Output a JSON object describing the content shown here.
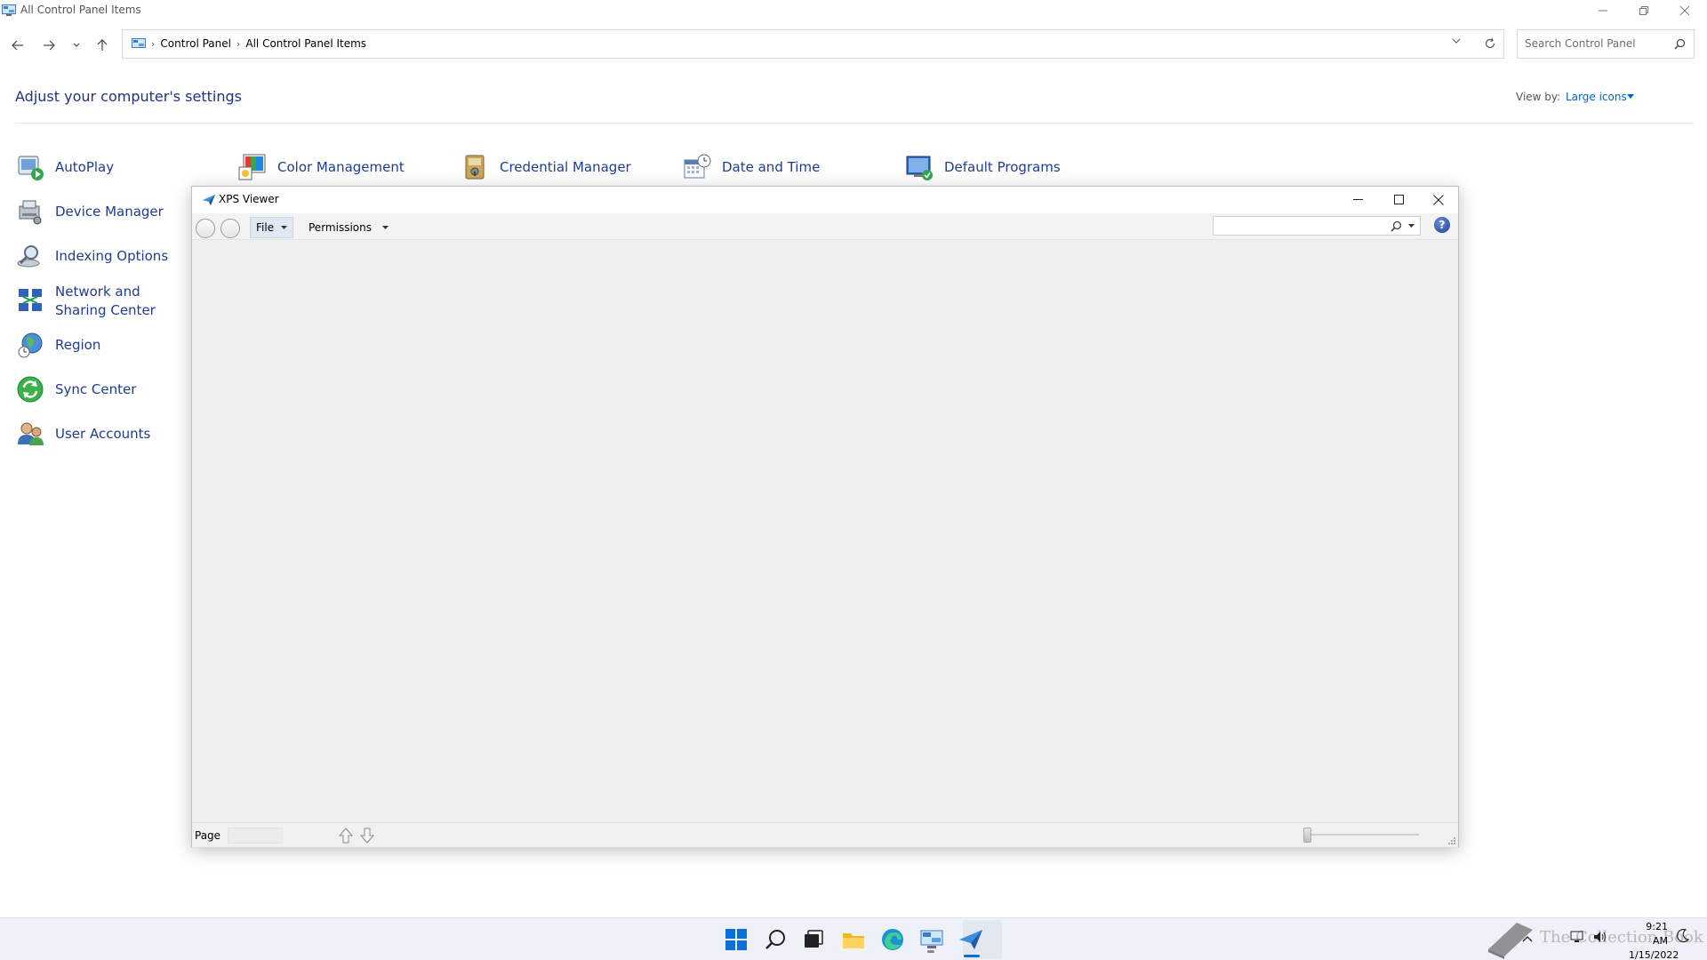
{
  "control_panel": {
    "window_title": "All Control Panel Items",
    "breadcrumbs": [
      "Control Panel",
      "All Control Panel Items"
    ],
    "search_placeholder": "Search Control Panel",
    "heading": "Adjust your computer's settings",
    "view_by_label": "View by:",
    "view_by_value": "Large icons",
    "items": [
      {
        "label": "AutoPlay",
        "icon": "autoplay-icon"
      },
      {
        "label": "Color Management",
        "icon": "color-management-icon"
      },
      {
        "label": "Credential Manager",
        "icon": "credential-manager-icon"
      },
      {
        "label": "Date and Time",
        "icon": "date-time-icon"
      },
      {
        "label": "Default Programs",
        "icon": "default-programs-icon"
      },
      {
        "label": "Device Manager",
        "icon": "device-manager-icon"
      },
      {
        "label": "Indexing Options",
        "icon": "indexing-options-icon"
      },
      {
        "label": "Network and Sharing Center",
        "icon": "network-sharing-icon"
      },
      {
        "label": "Region",
        "icon": "region-icon"
      },
      {
        "label": "Sync Center",
        "icon": "sync-center-icon"
      },
      {
        "label": "User Accounts",
        "icon": "user-accounts-icon"
      }
    ]
  },
  "xps_viewer": {
    "window_title": "XPS Viewer",
    "menu": {
      "file": "File",
      "permissions": "Permissions"
    },
    "search_value": "",
    "help_glyph": "?",
    "status": {
      "page_label": "Page",
      "page_value": ""
    },
    "zoom_level": 0.0
  },
  "taskbar": {
    "icons": [
      "start-icon",
      "search-icon",
      "task-view-icon",
      "file-explorer-icon",
      "edge-icon",
      "control-panel-icon",
      "xps-viewer-icon"
    ],
    "time": "9:21 AM",
    "date": "1/15/2022",
    "watermark": "The Collection Book"
  },
  "colors": {
    "link_blue": "#1e3c96",
    "heading_blue": "#1e3287",
    "accent_blue": "#0066cc",
    "taskbar_bg": "#eef1f7"
  }
}
